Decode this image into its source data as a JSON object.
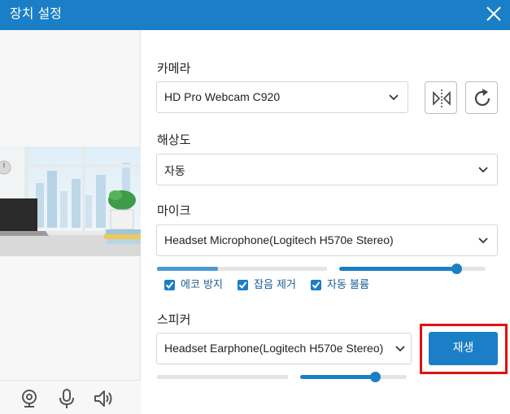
{
  "window": {
    "title": "장치 설정"
  },
  "camera": {
    "label": "카메라",
    "selected": "HD Pro Webcam C920"
  },
  "resolution": {
    "label": "해상도",
    "selected": "자동"
  },
  "mic": {
    "label": "마이크",
    "selected": "Headset Microphone(Logitech H570e Stereo)",
    "input_level": 0.36,
    "volume": 0.8,
    "options": {
      "echo": "에코 방지",
      "noise": "잡음 제거",
      "auto_volume": "자동 볼륨"
    }
  },
  "speaker": {
    "label": "스피커",
    "selected": "Headset Earphone(Logitech H570e Stereo)",
    "output_level": 0.0,
    "volume": 0.7,
    "play_label": "재생"
  },
  "colors": {
    "accent": "#1a7fc6",
    "highlight": "#e01010"
  }
}
